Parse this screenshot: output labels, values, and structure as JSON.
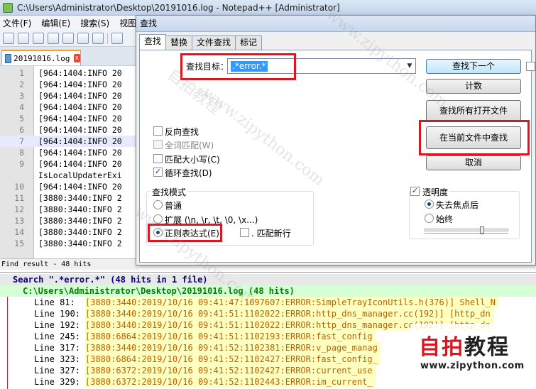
{
  "window": {
    "title": "C:\\Users\\Administrator\\Desktop\\20191016.log - Notepad++ [Administrator]"
  },
  "menu": [
    "文件(F)",
    "编辑(E)",
    "搜索(S)",
    "视图"
  ],
  "tab": {
    "label": "20191016.log",
    "close": "x"
  },
  "editor": {
    "current_line": 7,
    "lines": [
      {
        "n": "1",
        "text": "[964:1404:INFO 20"
      },
      {
        "n": "2",
        "text": "[964:1404:INFO 20"
      },
      {
        "n": "3",
        "text": "[964:1404:INFO 20"
      },
      {
        "n": "4",
        "text": "[964:1404:INFO 20"
      },
      {
        "n": "5",
        "text": "[964:1404:INFO 20"
      },
      {
        "n": "6",
        "text": "[964:1404:INFO 20"
      },
      {
        "n": "7",
        "text": "[964:1404:INFO 20"
      },
      {
        "n": "8",
        "text": "[964:1404:INFO 20"
      },
      {
        "n": "9",
        "text": "[964:1404:INFO 20"
      },
      {
        "n": "",
        "text": "IsLocalUpdaterExi"
      },
      {
        "n": "10",
        "text": "[964:1404:INFO 20"
      },
      {
        "n": "11",
        "text": "[3880:3440:INFO 2"
      },
      {
        "n": "12",
        "text": "[3880:3440:INFO 2"
      },
      {
        "n": "13",
        "text": "[3880:3440:INFO 2"
      },
      {
        "n": "14",
        "text": "[3880:3440:INFO 2"
      },
      {
        "n": "15",
        "text": "[3880:3440:INFO 2"
      }
    ]
  },
  "status": "Find result - 48 hits",
  "find_dialog": {
    "title": "查找",
    "tabs": [
      "查找",
      "替换",
      "文件查找",
      "标记"
    ],
    "target_label": "查找目标：",
    "target_value": ".*error.*",
    "buttons": {
      "find_next": "查找下一个",
      "count": "计数",
      "find_all_open": "查找所有打开文件",
      "find_all_current": "在当前文件中查找",
      "cancel": "取消"
    },
    "options": {
      "backward": "反向查找",
      "whole_word": "全词匹配(W)",
      "match_case": "匹配大小写(C)",
      "wrap": "循环查找(D)"
    },
    "search_mode": {
      "title": "查找模式",
      "normal": "普通",
      "extended": "扩展 (\\n, \\r, \\t, \\0, \\x...)",
      "regex": "正则表达式(E)",
      "dot_newline": ". 匹配新行"
    },
    "transparency": {
      "title": "透明度",
      "on_lose_focus": "失去焦点后",
      "always": "始终",
      "level": 0.7
    }
  },
  "results": {
    "search_line": "Search \".*error.*\" (48 hits in 1 file)",
    "file_line": "C:\\Users\\Administrator\\Desktop\\20191016.log (48 hits)",
    "hits": [
      {
        "line": "Line 81:",
        "text": "[3880:3440:2019/10/16 09:41:47:1097607:ERROR:SimpleTrayIconUtils.h(376)] Shell_N"
      },
      {
        "line": "Line 190:",
        "text": "[3880:3440:2019/10/16 09:41:51:1102022:ERROR:http_dns_manager.cc(192)] [http_dn"
      },
      {
        "line": "Line 192:",
        "text": "[3880:3440:2019/10/16 09:41:51:1102022:ERROR:http_dns_manager.cc(192)] [http_dn"
      },
      {
        "line": "Line 245:",
        "text": "[3880:6864:2019/10/16 09:41:51:1102193:ERROR:fast_config"
      },
      {
        "line": "Line 317:",
        "text": "[3880:3440:2019/10/16 09:41:52:1102381:ERROR:v_page_manag"
      },
      {
        "line": "Line 323:",
        "text": "[3880:6864:2019/10/16 09:41:52:1102427:ERROR:fast_config_"
      },
      {
        "line": "Line 327:",
        "text": "[3880:6372:2019/10/16 09:41:52:1102427:ERROR:current_use"
      },
      {
        "line": "Line 329:",
        "text": "[3880:6372:2019/10/16 09:41:52:1102443:ERROR:im_current_"
      }
    ]
  },
  "watermark": [
    "www.zipython.com",
    "www.zipython.com",
    "www.zipython.com",
    "自拍教程"
  ],
  "logo": {
    "red_text": "自拍",
    "dark_text": "教程",
    "url": "www.zipython.com"
  },
  "colors": {
    "highlight": "#e0141e",
    "selection": "#3399ff"
  }
}
